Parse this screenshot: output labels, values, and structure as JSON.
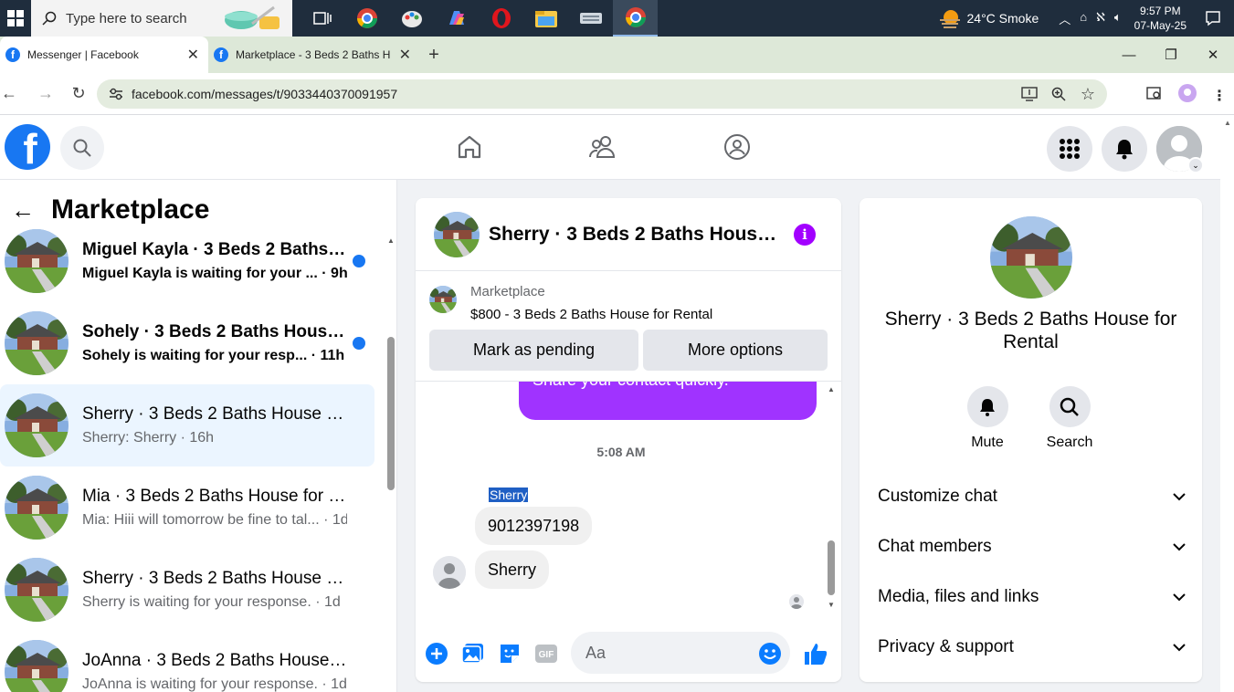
{
  "taskbar": {
    "search_placeholder": "Type here to search",
    "weather": "24°C  Smoke",
    "time": "9:57 PM",
    "date": "07-May-25"
  },
  "browser": {
    "tabs": [
      {
        "title": "Messenger | Facebook",
        "active": true
      },
      {
        "title": "Marketplace - 3 Beds 2 Baths H",
        "active": false
      }
    ],
    "url": "facebook.com/messages/t/9033440370091957"
  },
  "left_panel": {
    "title": "Marketplace",
    "conversations": [
      {
        "name": "Miguel Kayla · 3 Beds 2 Baths ...",
        "preview": "Miguel Kayla is waiting for your ... · 9h",
        "unread": true
      },
      {
        "name": "Sohely · 3 Beds 2 Baths House ...",
        "preview": "Sohely is waiting for your resp... · 11h",
        "unread": true
      },
      {
        "name": "Sherry · 3 Beds 2 Baths House fo...",
        "preview": "Sherry: Sherry · 16h",
        "unread": false,
        "selected": true
      },
      {
        "name": "Mia · 3 Beds 2 Baths House for R...",
        "preview": "Mia: Hiii will tomorrow be fine to tal... · 1d",
        "unread": false
      },
      {
        "name": "Sherry · 3 Beds 2 Baths House fo...",
        "preview": "Sherry is waiting for your response. · 1d",
        "unread": false
      },
      {
        "name": "JoAnna · 3 Beds 2 Baths House f...",
        "preview": "JoAnna is waiting for your response. · 1d",
        "unread": false
      }
    ]
  },
  "chat": {
    "title": "Sherry · 3 Beds 2 Baths House ...",
    "marketplace_label": "Marketplace",
    "listing": "$800 - 3 Beds 2 Baths House for Rental",
    "mark_pending_label": "Mark as pending",
    "more_options_label": "More options",
    "outgoing_message": "Share your contact quickly.",
    "timestamp": "5:08 AM",
    "sender_name": "Sherry",
    "incoming_messages": [
      "9012397198",
      "Sherry"
    ],
    "composer_placeholder": "Aa"
  },
  "details": {
    "name": "Sherry · 3 Beds 2 Baths House for Rental",
    "mute_label": "Mute",
    "search_label": "Search",
    "sections": [
      "Customize chat",
      "Chat members",
      "Media, files and links",
      "Privacy & support"
    ]
  },
  "colors": {
    "brand_blue": "#1877f2",
    "messenger_purple": "#a033ff",
    "selected_bg": "#ebf5ff"
  }
}
